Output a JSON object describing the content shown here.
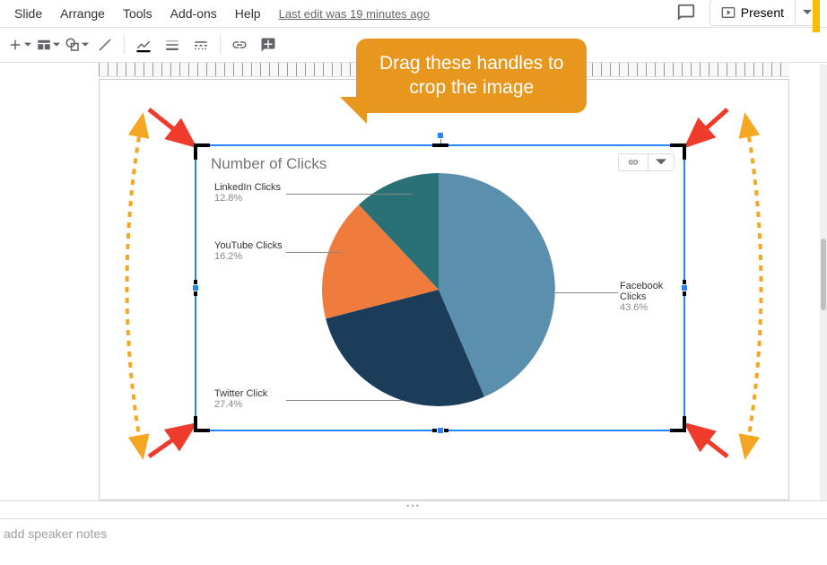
{
  "menu": {
    "slide": "Slide",
    "arrange": "Arrange",
    "tools": "Tools",
    "addons": "Add-ons",
    "help": "Help"
  },
  "last_edit": "Last edit was 19 minutes ago",
  "present_label": "Present",
  "callout": {
    "line1": "Drag these handles to",
    "line2": "crop the image"
  },
  "chart_data": {
    "type": "pie",
    "title": "Number of Clicks",
    "series": [
      {
        "name": "Facebook Clicks",
        "value": 43.6,
        "label": "43.6%",
        "color": "#5b8fae"
      },
      {
        "name": "Twitter Click",
        "value": 27.4,
        "label": "27.4%",
        "color": "#1c3d5a"
      },
      {
        "name": "YouTube Clicks",
        "value": 16.2,
        "label": "16.2%",
        "color": "#ef7b3c"
      },
      {
        "name": "LinkedIn Clicks",
        "value": 12.8,
        "label": "12.8%",
        "color": "#2a7177"
      }
    ]
  },
  "notes_placeholder": "add speaker notes"
}
